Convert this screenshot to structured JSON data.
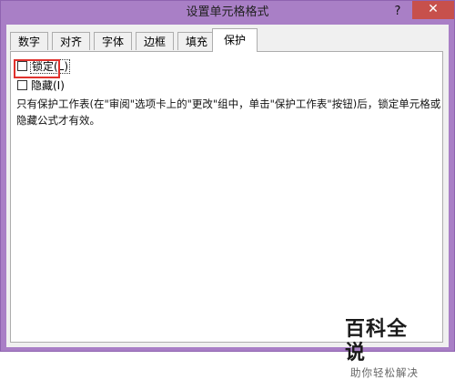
{
  "window": {
    "title": "设置单元格格式",
    "help_label": "?",
    "close_label": "✕"
  },
  "tabs": [
    {
      "label": "数字"
    },
    {
      "label": "对齐"
    },
    {
      "label": "字体"
    },
    {
      "label": "边框"
    },
    {
      "label": "填充"
    },
    {
      "label": "保护",
      "active": true
    }
  ],
  "protection": {
    "locked": {
      "label": "锁定(L)",
      "checked": false
    },
    "hidden": {
      "label": "隐藏(I)",
      "checked": false
    },
    "description": "只有保护工作表(在\"审阅\"选项卡上的\"更改\"组中，单击\"保护工作表\"按钮)后，锁定单元格或隐藏公式才有效。"
  },
  "watermark": {
    "main": "百科全说",
    "sub": "助你轻松解决"
  },
  "colors": {
    "title_bar": "#a97fc6",
    "close_button": "#c7504c",
    "highlight_box": "#e0312c"
  }
}
